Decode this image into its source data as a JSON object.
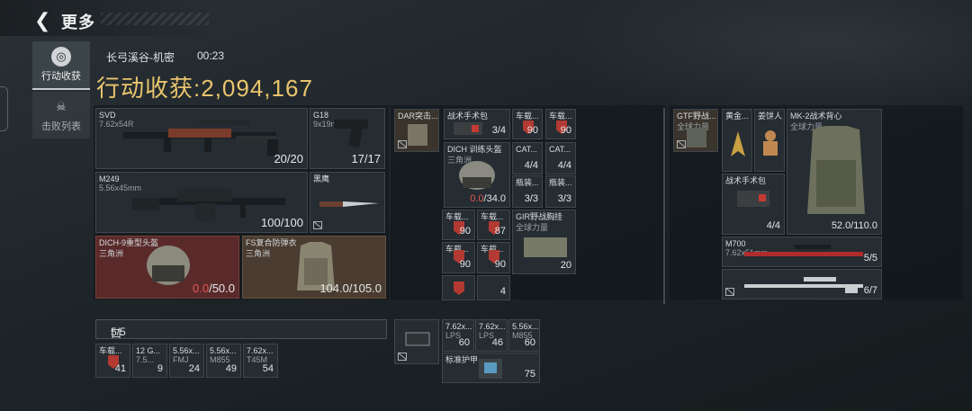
{
  "header": {
    "back_icon": "back-arrow-icon",
    "title": "更多"
  },
  "sidebar": [
    {
      "label": "行动收获",
      "icon": "target-icon",
      "active": true
    },
    {
      "label": "击败列表",
      "icon": "skull-icon",
      "active": false
    }
  ],
  "match": {
    "map": "长弓溪谷-机密",
    "time": "00:23",
    "gain_label": "行动收获:",
    "gain_value": "2,094,167"
  },
  "loadout": {
    "svd": {
      "name": "SVD",
      "sub": "7.62x54R",
      "count": "20/20"
    },
    "g18": {
      "name": "G18",
      "sub": "9x19mm",
      "count": "17/17"
    },
    "m249": {
      "name": "M249",
      "sub": "5.56x45mm",
      "count": "100/100"
    },
    "knife": {
      "name": "黑鹰"
    },
    "helmet": {
      "name": "DICH-9重型头盔",
      "sub": "三角洲",
      "dur_cur": "0.0",
      "dur_max": "/50.0"
    },
    "armor": {
      "name": "FS复合防弹衣",
      "sub": "三角洲",
      "dur": "104.0/105.0"
    }
  },
  "pocket": {
    "label": "口袋:",
    "count": "5/5",
    "items": [
      {
        "name": "车载...",
        "count": "41"
      },
      {
        "name": "12 G...",
        "sub": "7.5...",
        "count": "9"
      },
      {
        "name": "5.56x...",
        "sub": "FMJ",
        "count": "24"
      },
      {
        "name": "5.56x...",
        "sub": "M855",
        "count": "49"
      },
      {
        "name": "7.62x...",
        "sub": "T45M",
        "count": "54"
      }
    ]
  },
  "chest": {
    "rig": {
      "name": "DAR突击..."
    },
    "items": [
      {
        "name": "战术手术包",
        "count": "3/4"
      },
      {
        "name": "车载...",
        "count": "90"
      },
      {
        "name": "车载...",
        "count": "90"
      },
      {
        "name": "DICH 训练头盔",
        "sub": "三角洲",
        "dur_cur": "0.0",
        "dur_max": "/34.0"
      },
      {
        "name": "CAT...",
        "count": "4/4"
      },
      {
        "name": "CAT...",
        "count": "4/4"
      },
      {
        "name": "瓶装...",
        "count": "3/3"
      },
      {
        "name": "瓶装...",
        "count": "3/3"
      },
      {
        "name": "车载...",
        "count": "90"
      },
      {
        "name": "车载...",
        "count": "87"
      },
      {
        "name": "GIR野战胸挂",
        "sub": "全球力量",
        "count": "20"
      },
      {
        "name": "车载...",
        "count": "90"
      },
      {
        "name": "车载...",
        "count": "90"
      },
      {
        "name": "车载...",
        "count": ""
      },
      {
        "name": "",
        "count": "4"
      }
    ]
  },
  "backpack_small": {
    "items": [
      {
        "name": "7.62x...",
        "sub": "LPS",
        "count": "60"
      },
      {
        "name": "7.62x...",
        "sub": "LPS",
        "count": "46"
      },
      {
        "name": "5.56x...",
        "sub": "M855",
        "count": "60"
      }
    ],
    "armor": {
      "name": "标准护甲",
      "count": "75"
    }
  },
  "backpack": {
    "rig": {
      "name": "GTF野战...",
      "sub": "全球力量"
    },
    "gold": {
      "name": "黄金..."
    },
    "cookie": {
      "name": "姜饼人"
    },
    "vest": {
      "name": "MK-2战术背心",
      "sub": "全球力量",
      "dur": "52.0/110.0"
    },
    "kit": {
      "name": "战术手术包",
      "count": "4/4"
    },
    "m700": {
      "name": "M700",
      "sub": "7.62x51mm",
      "count": "5/5"
    },
    "sniper": {
      "count": "6/7"
    }
  },
  "colors": {
    "gain": "#e9c56d",
    "broken": "#e25a52"
  }
}
